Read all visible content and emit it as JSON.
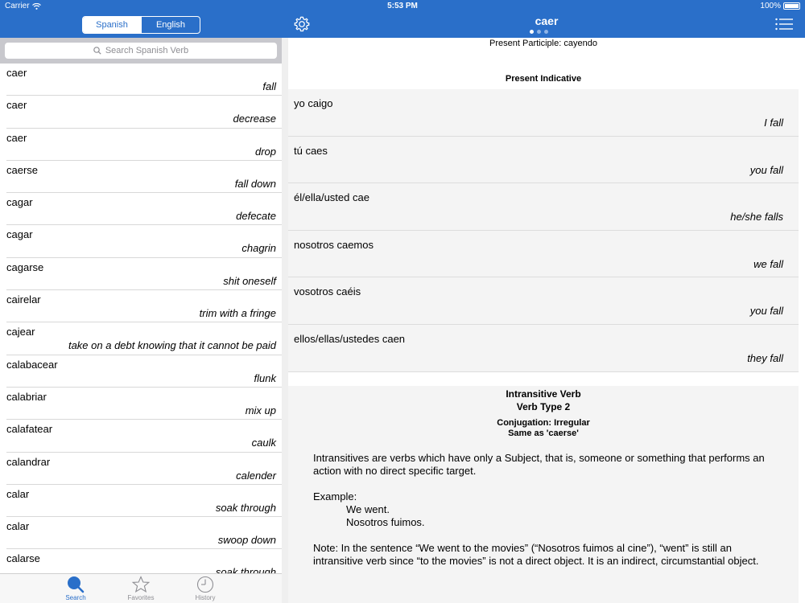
{
  "status": {
    "carrier": "Carrier",
    "time": "5:53 PM",
    "battery": "100%"
  },
  "segment": {
    "spanish": "Spanish",
    "english": "English"
  },
  "nav": {
    "title": "caer"
  },
  "search": {
    "placeholder": "Search Spanish Verb"
  },
  "verbs": [
    {
      "es": "caer",
      "en": "fall"
    },
    {
      "es": "caer",
      "en": "decrease"
    },
    {
      "es": "caer",
      "en": "drop"
    },
    {
      "es": "caerse",
      "en": "fall down"
    },
    {
      "es": "cagar",
      "en": "defecate"
    },
    {
      "es": "cagar",
      "en": "chagrin"
    },
    {
      "es": "cagarse",
      "en": "shit oneself"
    },
    {
      "es": "cairelar",
      "en": "trim with a fringe"
    },
    {
      "es": "cajear",
      "en": "take on a debt knowing that it cannot be paid"
    },
    {
      "es": "calabacear",
      "en": "flunk"
    },
    {
      "es": "calabriar",
      "en": "mix up"
    },
    {
      "es": "calafatear",
      "en": "caulk"
    },
    {
      "es": "calandrar",
      "en": "calender"
    },
    {
      "es": "calar",
      "en": "soak through"
    },
    {
      "es": "calar",
      "en": "swoop down"
    },
    {
      "es": "calarse",
      "en": "soak through"
    }
  ],
  "tabs": {
    "search": "Search",
    "favorites": "Favorites",
    "history": "History"
  },
  "detail": {
    "participle": "Present Participle:  cayendo",
    "section": "Present Indicative",
    "conjugations": [
      {
        "es": "yo caigo",
        "en": "I fall"
      },
      {
        "es": "tú caes",
        "en": "you fall"
      },
      {
        "es": "él/ella/usted cae",
        "en": "he/she falls"
      },
      {
        "es": "nosotros caemos",
        "en": "we fall"
      },
      {
        "es": "vosotros caéis",
        "en": "you fall"
      },
      {
        "es": "ellos/ellas/ustedes caen",
        "en": "they fall"
      }
    ],
    "notes": {
      "title1": "Intransitive Verb",
      "title2": "Verb Type 2",
      "conjugation": "Conjugation: Irregular",
      "same_as": "Same as 'caerse'",
      "paragraph1": "Intransitives are verbs which have only a Subject, that is, someone or something that performs an action with no direct specific target.",
      "example_label": "Example:",
      "example_en": "We went.",
      "example_es": "Nosotros fuimos.",
      "note": "Note: In the sentence “We went to the movies” (“Nosotros fuimos al cine”), “went” is still an intransitive verb since “to the movies” is not a direct object. It is an indirect, circumstantial object."
    }
  },
  "colors": {
    "accent": "#2a6fc9"
  }
}
